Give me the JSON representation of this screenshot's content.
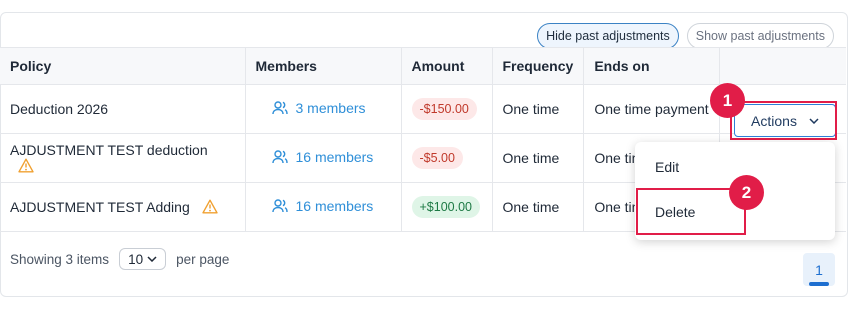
{
  "toggles": {
    "hide_past": "Hide past adjustments",
    "show_past": "Show past adjustments"
  },
  "table": {
    "headers": [
      "Policy",
      "Members",
      "Amount",
      "Frequency",
      "Ends on",
      ""
    ],
    "rows": [
      {
        "policy": "Deduction 2026",
        "warning": false,
        "members": "3 members",
        "amount": "-$150.00",
        "amount_type": "negative",
        "frequency": "One time",
        "ends_on": "One time payment"
      },
      {
        "policy": "AJDUSTMENT TEST deduction",
        "warning": true,
        "members": "16 members",
        "amount": "-$5.00",
        "amount_type": "negative",
        "frequency": "One time",
        "ends_on": "One tim"
      },
      {
        "policy": "AJDUSTMENT TEST Adding",
        "warning": true,
        "members": "16 members",
        "amount": "+$100.00",
        "amount_type": "positive",
        "frequency": "One time",
        "ends_on": "One tim"
      }
    ]
  },
  "actions": {
    "label": "Actions",
    "menu": [
      "Edit",
      "Delete"
    ]
  },
  "markers": [
    "1",
    "2"
  ],
  "footer": {
    "showing": "Showing 3 items",
    "per_page_value": "10",
    "per_page_label": "per page",
    "current_page": "1"
  },
  "colors": {
    "accent": "#2f8fd8",
    "marker": "#e11d48",
    "warning": "#f0a030"
  }
}
